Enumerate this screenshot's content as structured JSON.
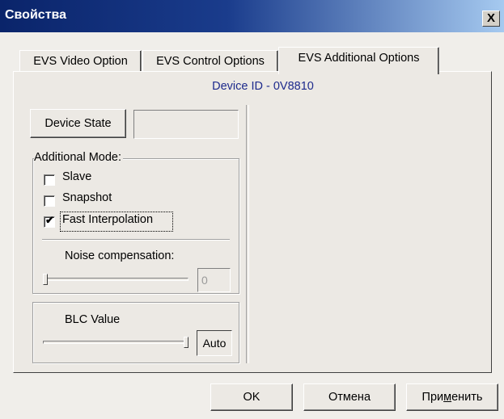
{
  "window": {
    "title": "Свойства",
    "close_glyph": "X"
  },
  "tabs": [
    {
      "label": "EVS Video Option",
      "active": false
    },
    {
      "label": "EVS Control Options",
      "active": false
    },
    {
      "label": "EVS Additional Options",
      "active": true
    }
  ],
  "panel": {
    "device_id": "Device ID - 0V8810",
    "device_state_label": "Device State",
    "device_state_value": "",
    "additional_mode": {
      "legend": "Additional Mode:",
      "options": [
        {
          "label": "Slave",
          "checked": false
        },
        {
          "label": "Snapshot",
          "checked": false
        },
        {
          "label": "Fast Interpolation",
          "checked": true
        }
      ],
      "noise_label": "Noise compensation:",
      "noise_value": "0",
      "noise_level": 0
    },
    "blc": {
      "label": "BLC Value",
      "value": "Auto",
      "level": 1
    }
  },
  "buttons": {
    "ok": "OK",
    "cancel": "Отмена",
    "apply_pre": "При",
    "apply_mnemonic": "м",
    "apply_post": "енить"
  },
  "colors": {
    "title_bar_start": "#0a246a",
    "title_bar_end": "#a6caf0",
    "device_id_text": "#1d2a8c",
    "face": "#ece9e4"
  }
}
